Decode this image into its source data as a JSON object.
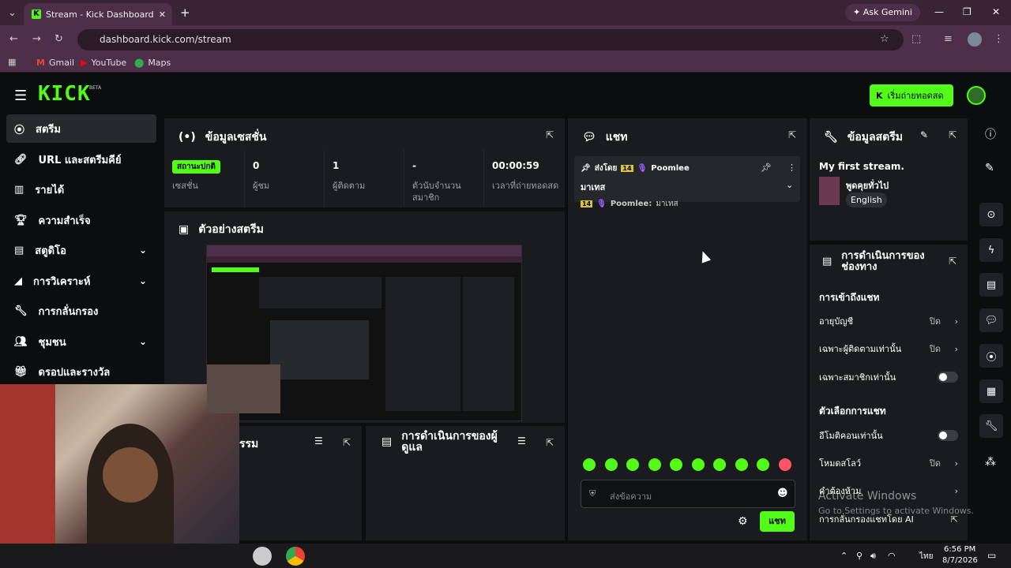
{
  "browser": {
    "tab_title": "Stream - Kick Dashboard",
    "ask": "Ask Gemini",
    "url": "dashboard.kick.com/stream",
    "bookmarks": [
      "Gmail",
      "YouTube",
      "Maps"
    ]
  },
  "header": {
    "logo": "KICK",
    "beta": "BETA",
    "go_live": "เริ่มถ่ายทอดสด"
  },
  "sidebar": {
    "items": [
      {
        "label": "สตรีม"
      },
      {
        "label": "URL และสตรีมคีย์"
      },
      {
        "label": "รายได้"
      },
      {
        "label": "ความสำเร็จ"
      },
      {
        "label": "สตูดิโอ"
      },
      {
        "label": "การวิเคราะห์"
      },
      {
        "label": "การกลั่นกรอง"
      },
      {
        "label": "ชุมชน"
      },
      {
        "label": "ดรอปและรางวัล"
      }
    ]
  },
  "session": {
    "title": "ข้อมูลเซสชั่น",
    "stats": [
      {
        "value": "สถานะปกติ",
        "label": "เซสชั่น"
      },
      {
        "value": "0",
        "label": "ผู้ชม"
      },
      {
        "value": "1",
        "label": "ผู้ติดตาม"
      },
      {
        "value": "-",
        "label": "ตัวนับจำนวนสมาชิก"
      },
      {
        "value": "00:00:59",
        "label": "เวลาที่ถ่ายทอดสด"
      }
    ]
  },
  "preview": {
    "title": "ตัวอย่างสตรีม"
  },
  "activity": {
    "title": "กิจกรรม",
    "visible_title": "รรม"
  },
  "mod_actions": {
    "title": "การดำเนินการของผู้ดูแล"
  },
  "chat": {
    "title": "แชท",
    "pinned_by": "ส่งโดย",
    "pinned_user": "Poomlee",
    "pinned_msg": "มาเทส",
    "msg_user": "Poomlee:",
    "msg_text": "มาเทส",
    "input_placeholder": "ส่งข้อความ",
    "send": "แชท",
    "badge": "14"
  },
  "stream_info": {
    "title": "ข้อมูลสตรีม",
    "stream_title": "My first stream.",
    "category": "พูดคุยทั่วไป",
    "language": "English"
  },
  "channel_actions": {
    "title": "การดำเนินการของช่องทาง",
    "section1": "การเข้าถึงแชท",
    "rows1": [
      {
        "label": "อายุบัญชี",
        "value": "ปิด"
      },
      {
        "label": "เฉพาะผู้ติดตามเท่านั้น",
        "value": "ปิด"
      },
      {
        "label": "เฉพาะสมาชิกเท่านั้น",
        "value": ""
      }
    ],
    "section2": "ตัวเลือกการแชท",
    "rows2": [
      {
        "label": "อีโมติคอนเท่านั้น",
        "value": ""
      },
      {
        "label": "โหมดสโลว์",
        "value": "ปิด"
      },
      {
        "label": "คำต้องห้าม",
        "value": ""
      },
      {
        "label": "การกลั่นกรองแชทโดย AI",
        "value": ""
      }
    ]
  },
  "overlay": {
    "activate": "Activate Windows",
    "activate_sub": "Go to Settings to activate Windows."
  },
  "taskbar": {
    "time": "6:56 PM",
    "date": "8/7/2026",
    "lang": "ไทย"
  }
}
